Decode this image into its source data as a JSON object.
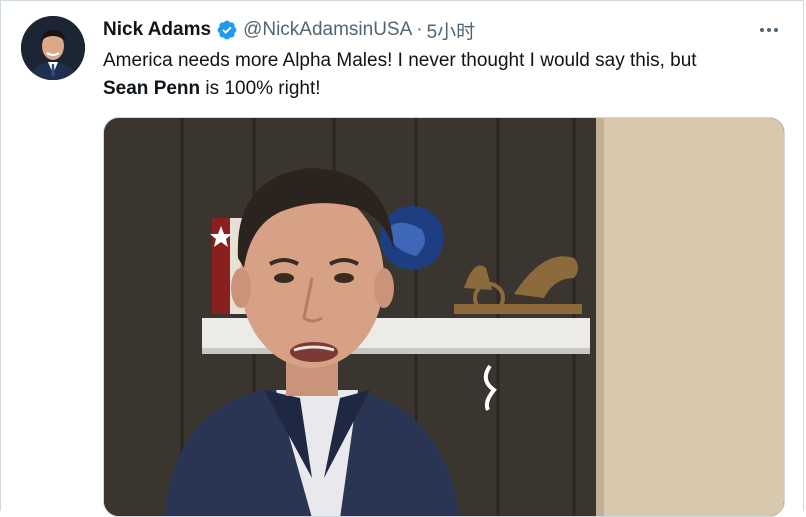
{
  "tweet": {
    "author": {
      "display_name": "Nick Adams",
      "handle": "@NickAdamsinUSA",
      "verified": true
    },
    "separator": "·",
    "timestamp": "5小时",
    "text": {
      "line1": "America needs more Alpha Males! I never thought I would say this, but",
      "bold": "Sean Penn",
      "line2_rest": " is 100% right!"
    },
    "icons": {
      "verified": "verified-badge-icon",
      "more": "more-options-icon"
    },
    "colors": {
      "verified_blue": "#1d9bf0",
      "secondary_text": "#536471",
      "primary_text": "#0f1419"
    }
  }
}
